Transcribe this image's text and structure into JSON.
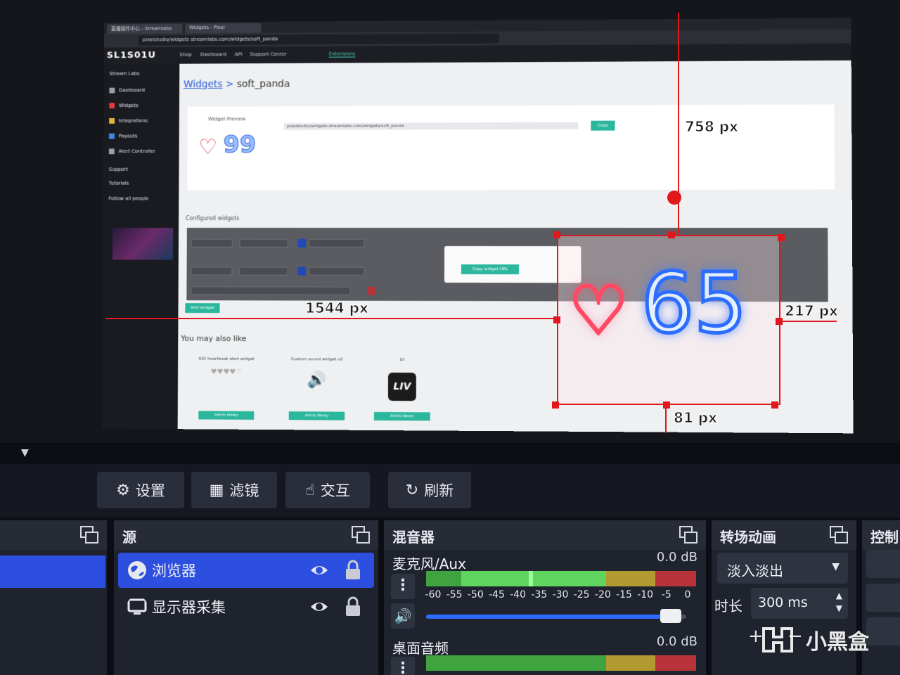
{
  "browser": {
    "tabs": [
      "直播插件中心 - Streamlabs",
      "Widgets - Pixel"
    ],
    "url": "pixelstudio/widgets  streamlabs.com/widgets/soft_panda"
  },
  "site": {
    "logo": "SL1S01U",
    "nav": [
      "Shop",
      "Dashboard",
      "API",
      "Support Center",
      "Extensions"
    ],
    "sidebar": [
      {
        "label": "Dashboard",
        "color": "#9aa0aa"
      },
      {
        "label": "Widgets",
        "color": "#e53a3a"
      },
      {
        "label": "Integrations",
        "color": "#e5b23a"
      },
      {
        "label": "Payouts",
        "color": "#3a8be5"
      },
      {
        "label": "Alert Controller",
        "color": "#9aa0aa"
      }
    ],
    "sidebar_sections": [
      "Stream Labs",
      "Support",
      "Tutorials",
      "Follow all people"
    ],
    "breadcrumb_link": "Widgets",
    "breadcrumb_current": "soft_panda",
    "widget_preview_label": "Widget Preview",
    "preview_count": "99",
    "copy_label": "Copy",
    "configured_label": "Configured widgets",
    "popup_button": "Copy widget URL",
    "add_button": "Add widget",
    "may_also_like": "You may also like",
    "suggestions": [
      {
        "title": "SO! heartbeat alert widget",
        "button": "Add to library"
      },
      {
        "title": "Custom sound widget v2",
        "button": "Add to library"
      },
      {
        "title": "LV",
        "button": "Add to library",
        "logo": "LIV"
      }
    ]
  },
  "overlay": {
    "heart_count": "65",
    "dim_top": "758 px",
    "dim_left": "1544 px",
    "dim_right": "217 px",
    "dim_bottom": "81 px"
  },
  "toolbar": {
    "settings": "设置",
    "filters": "滤镜",
    "interact": "交互",
    "refresh": "刷新"
  },
  "sources": {
    "title": "源",
    "items": [
      {
        "name": "浏览器",
        "selected": true
      },
      {
        "name": "显示器采集",
        "selected": false
      }
    ]
  },
  "mixer": {
    "title": "混音器",
    "channels": [
      {
        "name": "麦克风/Aux",
        "db": "0.0 dB",
        "volume_fraction": 0.97
      },
      {
        "name": "桌面音频",
        "db": "0.0 dB"
      }
    ],
    "ticks": [
      "-60",
      "-55",
      "-50",
      "-45",
      "-40",
      "-35",
      "-30",
      "-25",
      "-20",
      "-15",
      "-10",
      "-5",
      "0"
    ]
  },
  "transitions": {
    "title": "转场动画",
    "selected": "淡入淡出",
    "duration_label": "时长",
    "duration_value": "300 ms",
    "add": "+",
    "remove": "−"
  },
  "controls": {
    "title": "控制"
  },
  "watermark": "小黑盒",
  "colors": {
    "accent_blue": "#2d4fe0",
    "guide_red": "#e0181c",
    "teal": "#2bb79d"
  }
}
